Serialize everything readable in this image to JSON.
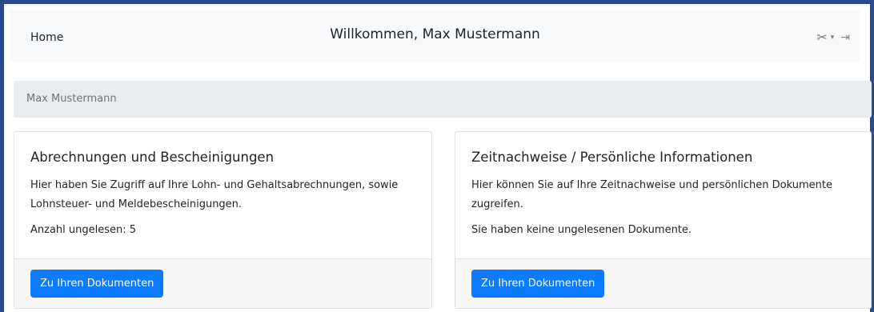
{
  "navbar": {
    "home_label": "Home",
    "title": "Willkommen, Max Mustermann",
    "tools_icon": "tools-icon",
    "dropdown_caret": "▾",
    "logout_icon": "logout-icon"
  },
  "breadcrumb": {
    "current": "Max Mustermann"
  },
  "cards": [
    {
      "title": "Abrechnungen und Bescheinigungen",
      "text_line1": "Hier haben Sie Zugriff auf Ihre Lohn- und Gehaltsabrechnungen, sowie",
      "text_line2": "Lohnsteuer- und Meldebescheinigungen.",
      "status": "Anzahl ungelesen: 5",
      "button_label": "Zu Ihren Dokumenten"
    },
    {
      "title": "Zeitnachweise / Persönliche Informationen",
      "text_line1": "Hier können Sie auf Ihre Zeitnachweise und persönlichen Dokumente",
      "text_line2": "zugreifen.",
      "status": "Sie haben keine ungelesenen Dokumente.",
      "button_label": "Zu Ihren Dokumenten"
    }
  ],
  "colors": {
    "primary": "#0d7bff",
    "frame_border": "#2b4a8b",
    "navbar_bg": "#f8f9fa",
    "breadcrumb_bg": "#e9ecef"
  }
}
